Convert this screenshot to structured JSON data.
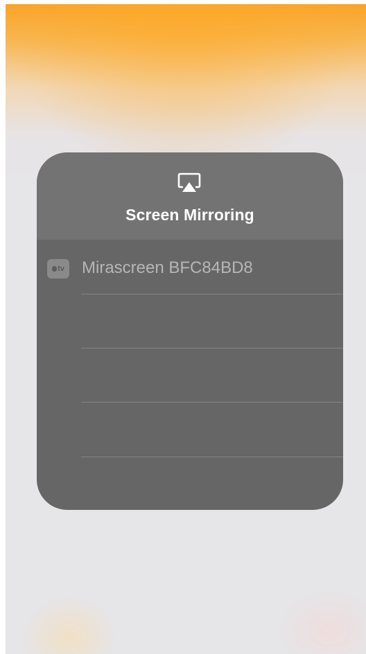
{
  "panel": {
    "title": "Screen Mirroring",
    "header_icon": "airplay-icon"
  },
  "devices": [
    {
      "name": "Mirascreen BFC84BD8",
      "icon": "apple-tv-icon",
      "icon_text": "tv"
    }
  ],
  "colors": {
    "panel_background": "#666666",
    "header_background": "#737373",
    "title_text": "#ffffff",
    "device_text": "#b6b6b6",
    "separator": "#858585",
    "wallpaper_accent": "#f9a224"
  }
}
